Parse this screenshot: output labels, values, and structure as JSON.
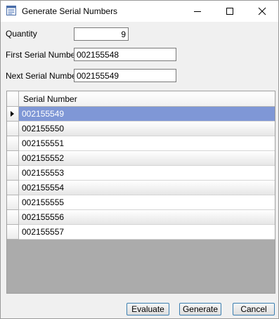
{
  "window": {
    "title": "Generate Serial Numbers"
  },
  "form": {
    "quantity_label": "Quantity",
    "quantity_value": "9",
    "first_serial_label": "First Serial Number",
    "first_serial_value": "002155548",
    "next_serial_label": "Next Serial Number",
    "next_serial_value": "002155549"
  },
  "grid": {
    "column_header": "Serial Number",
    "rows": [
      "002155549",
      "002155550",
      "002155551",
      "002155552",
      "002155553",
      "002155554",
      "002155555",
      "002155556",
      "002155557"
    ],
    "selected_index": 0
  },
  "buttons": {
    "evaluate": "Evaluate",
    "generate": "Generate",
    "cancel": "Cancel"
  },
  "colors": {
    "selection": "#7f97d6",
    "button_border": "#3c7fb1"
  }
}
